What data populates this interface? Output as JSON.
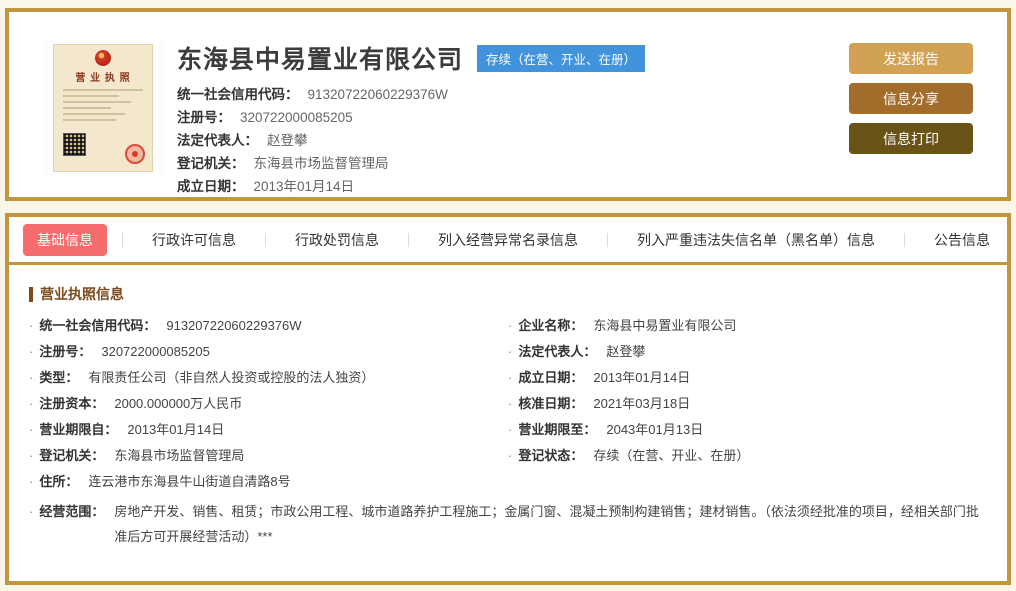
{
  "colors": {
    "page_background": "#FAF6EA",
    "gold_border": "#C1963F",
    "status_badge_blue": "#4193DB",
    "active_tab_red": "#F56C6C",
    "section_title_brown": "#7B4A1D",
    "button_send": "#D2A254",
    "button_share": "#A26C2B",
    "button_print": "#6A5317"
  },
  "header": {
    "company_name": "东海县中易置业有限公司",
    "status_badge": "存续（在营、开业、在册）",
    "license": {
      "title": "营 业 执 照"
    },
    "fields": [
      {
        "label": "统一社会信用代码：",
        "value": "91320722060229376W"
      },
      {
        "label": "注册号：",
        "value": "320722000085205"
      },
      {
        "label": "法定代表人：",
        "value": "赵登攀"
      },
      {
        "label": "登记机关：",
        "value": "东海县市场监督管理局"
      },
      {
        "label": "成立日期：",
        "value": "2013年01月14日"
      }
    ],
    "buttons": [
      {
        "label": "发送报告"
      },
      {
        "label": "信息分享"
      },
      {
        "label": "信息打印"
      }
    ]
  },
  "tabs": {
    "items": [
      {
        "label": "基础信息",
        "active": true
      },
      {
        "label": "行政许可信息",
        "active": false
      },
      {
        "label": "行政处罚信息",
        "active": false
      },
      {
        "label": "列入经营异常名录信息",
        "active": false
      },
      {
        "label": "列入严重违法失信名单（黑名单）信息",
        "active": false
      },
      {
        "label": "公告信息",
        "active": false
      }
    ]
  },
  "content": {
    "bullet": "·",
    "section_title": "营业执照信息",
    "left_fields": [
      {
        "label": "统一社会信用代码：",
        "value": "91320722060229376W"
      },
      {
        "label": "注册号：",
        "value": "320722000085205"
      },
      {
        "label": "类型：",
        "value": "有限责任公司（非自然人投资或控股的法人独资）"
      },
      {
        "label": "注册资本：",
        "value": "2000.000000万人民币"
      },
      {
        "label": "营业期限自：",
        "value": "2013年01月14日"
      },
      {
        "label": "登记机关：",
        "value": "东海县市场监督管理局"
      },
      {
        "label": "住所：",
        "value": "连云港市东海县牛山街道自清路8号"
      }
    ],
    "right_fields": [
      {
        "label": "企业名称：",
        "value": "东海县中易置业有限公司"
      },
      {
        "label": "法定代表人：",
        "value": "赵登攀"
      },
      {
        "label": "成立日期：",
        "value": "2013年01月14日"
      },
      {
        "label": "核准日期：",
        "value": "2021年03月18日"
      },
      {
        "label": "营业期限至：",
        "value": "2043年01月13日"
      },
      {
        "label": "登记状态：",
        "value": "存续（在营、开业、在册）"
      }
    ],
    "scope_field": {
      "label": "经营范围：",
      "value": "房地产开发、销售、租赁；市政公用工程、城市道路养护工程施工；金属门窗、混凝土预制构建销售；建材销售。（依法须经批准的项目，经相关部门批准后方可开展经营活动）***"
    }
  }
}
